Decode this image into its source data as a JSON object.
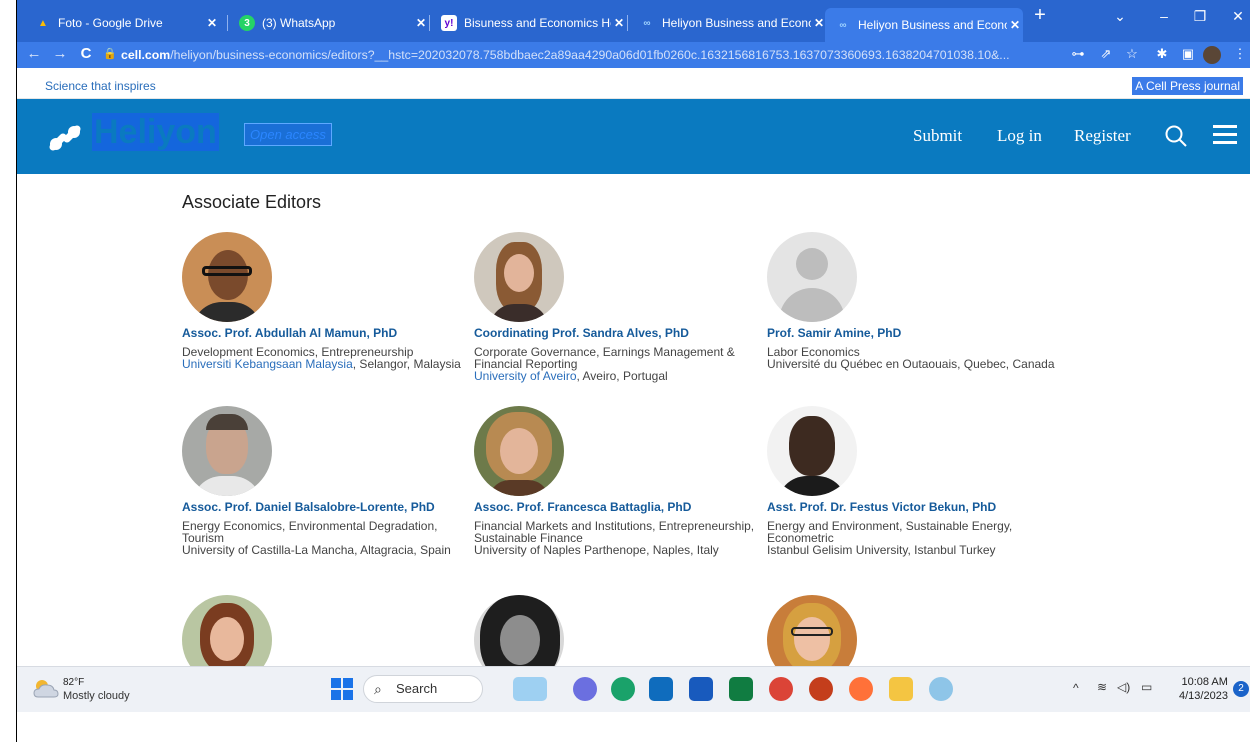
{
  "browser": {
    "tabs": [
      {
        "label": "Foto - Google Drive",
        "icon": "google-drive-icon"
      },
      {
        "label": "(3) WhatsApp",
        "icon": "whatsapp-icon"
      },
      {
        "label": "Bisuness and Economics Heli",
        "icon": "yahoo-icon"
      },
      {
        "label": "Heliyon Business and Econor",
        "icon": "heliyon-icon"
      },
      {
        "label": "Heliyon Business and Econor",
        "icon": "heliyon-icon",
        "active": true
      }
    ],
    "url_host": "cell.com",
    "url_path": "/heliyon/business-economics/editors?__hstc=202032078.758bdbaec2a89aa4290a06d01fb0260c.1632156816753.1637073360693.1638204701038.10&..."
  },
  "site": {
    "tagline": "Science that inspires",
    "cell_press": "A Cell Press journal",
    "logo": "Heliyon",
    "open_access": "Open access",
    "nav": {
      "submit": "Submit",
      "login": "Log in",
      "register": "Register"
    }
  },
  "section_title": "Associate Editors",
  "editors": [
    {
      "name": "Assoc. Prof. Abdullah Al Mamun, PhD",
      "fields": "Development Economics, Entrepreneurship",
      "uni_link": "Universiti Kebangsaan Malaysia",
      "location": ", Selangor, Malaysia"
    },
    {
      "name": "Coordinating Prof. Sandra Alves, PhD",
      "fields": "Corporate Governance, Earnings Management & Financial Reporting",
      "uni_link": "University of Aveiro",
      "location": ", Aveiro, Portugal"
    },
    {
      "name": "Prof. Samir Amine, PhD",
      "fields": "Labor Economics",
      "uni_link": "",
      "location": "Université du Québec en Outaouais, Quebec, Canada"
    },
    {
      "name": "Assoc. Prof. Daniel Balsalobre-Lorente, PhD",
      "fields": "Energy Economics, Environmental Degradation, Tourism",
      "uni_link": "",
      "location": "University of Castilla-La Mancha, Altagracia, Spain"
    },
    {
      "name": "Assoc. Prof. Francesca Battaglia, PhD",
      "fields": "Financial Markets and Institutions, Entrepreneurship, Sustainable Finance",
      "uni_link": "",
      "location": "University of Naples Parthenope, Naples, Italy"
    },
    {
      "name": "Asst. Prof. Dr. Festus Victor Bekun, PhD",
      "fields": "Energy and Environment, Sustainable Energy, Econometric",
      "uni_link": "",
      "location": "Istanbul Gelisim University, Istanbul Turkey"
    }
  ],
  "taskbar": {
    "temp": "82°F",
    "weather": "Mostly cloudy",
    "search": "Search",
    "time": "10:08 AM",
    "date": "4/13/2023",
    "notif_count": "2"
  }
}
